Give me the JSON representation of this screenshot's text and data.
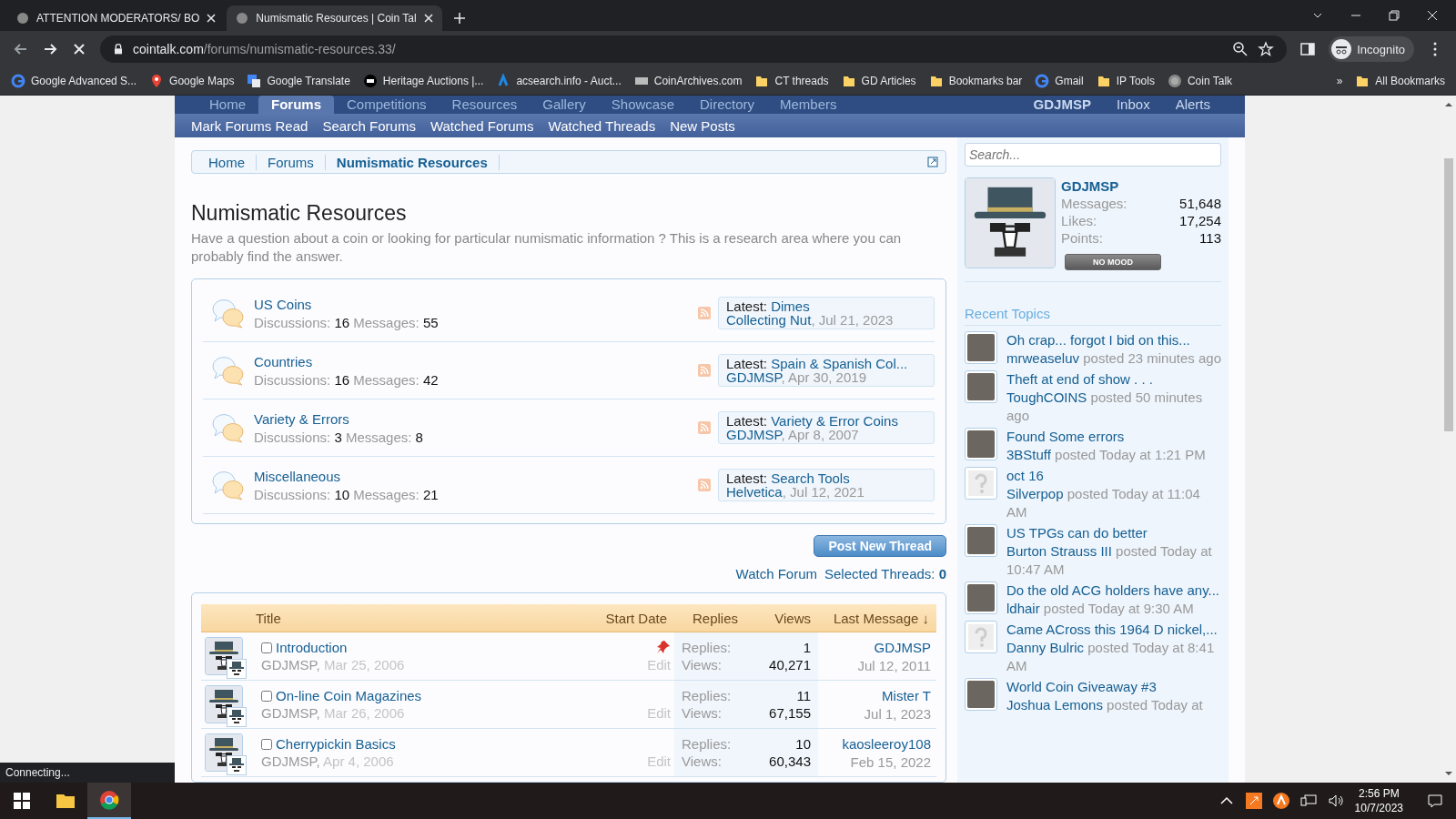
{
  "browser": {
    "tabs": [
      {
        "title": "ATTENTION MODERATORS/ BO",
        "selected": false
      },
      {
        "title": "Numismatic Resources | Coin Tal",
        "selected": true
      }
    ],
    "address": {
      "domain": "cointalk.com",
      "path": "/forums/numismatic-resources.33/"
    },
    "profile": "Incognito",
    "bookmarks": [
      {
        "label": "Google Advanced S...",
        "kind": "google"
      },
      {
        "label": "Google Maps",
        "kind": "pin"
      },
      {
        "label": "Google Translate",
        "kind": "translate"
      },
      {
        "label": "Heritage Auctions |...",
        "kind": "ha"
      },
      {
        "label": "acsearch.info - Auct...",
        "kind": "ac"
      },
      {
        "label": "CoinArchives.com",
        "kind": "ca"
      },
      {
        "label": "CT threads",
        "kind": "folder"
      },
      {
        "label": "GD Articles",
        "kind": "folder"
      },
      {
        "label": "Bookmarks bar",
        "kind": "folder"
      },
      {
        "label": "Gmail",
        "kind": "google"
      },
      {
        "label": "IP Tools",
        "kind": "folder"
      },
      {
        "label": "Coin Talk",
        "kind": "coin"
      }
    ],
    "overflow": "»",
    "all_bookmarks": "All Bookmarks"
  },
  "nav": {
    "items": [
      {
        "label": "Home",
        "selected": false
      },
      {
        "label": "Forums",
        "selected": true
      },
      {
        "label": "Competitions",
        "selected": false
      },
      {
        "label": "Resources",
        "selected": false
      },
      {
        "label": "Gallery",
        "selected": false
      },
      {
        "label": "Showcase",
        "selected": false
      },
      {
        "label": "Directory",
        "selected": false
      },
      {
        "label": "Members",
        "selected": false
      }
    ],
    "user_links": [
      "GDJMSP",
      "Inbox",
      "Alerts"
    ],
    "sub_items": [
      "Mark Forums Read",
      "Search Forums",
      "Watched Forums",
      "Watched Threads",
      "New Posts"
    ],
    "search": {
      "placeholder": "Search..."
    }
  },
  "breadcrumb": [
    {
      "label": "Home",
      "selected": false
    },
    {
      "label": "Forums",
      "selected": false
    },
    {
      "label": "Numismatic Resources",
      "selected": true
    }
  ],
  "title": "Numismatic Resources",
  "description": "Have a question about a coin or looking for particular numismatic information ? This is a research area where you can probably find the answer.",
  "forums": [
    {
      "name": "US Coins",
      "discussions_label": "Discussions:",
      "discussions": "16",
      "messages_label": "Messages:",
      "messages": "55",
      "latest_label": "Latest:",
      "latest_title": "Dimes",
      "latest_user": "Collecting Nut",
      "comma": ",",
      "latest_date": "Jul 21, 2023"
    },
    {
      "name": "Countries",
      "discussions_label": "Discussions:",
      "discussions": "16",
      "messages_label": "Messages:",
      "messages": "42",
      "latest_label": "Latest:",
      "latest_title": "Spain & Spanish Col...",
      "latest_user": "GDJMSP",
      "comma": ",",
      "latest_date": "Apr 30, 2019"
    },
    {
      "name": "Variety & Errors",
      "discussions_label": "Discussions:",
      "discussions": "3",
      "messages_label": "Messages:",
      "messages": "8",
      "latest_label": "Latest:",
      "latest_title": "Variety & Error Coins",
      "latest_user": "GDJMSP",
      "comma": ",",
      "latest_date": "Apr 8, 2007"
    },
    {
      "name": "Miscellaneous",
      "discussions_label": "Discussions:",
      "discussions": "10",
      "messages_label": "Messages:",
      "messages": "21",
      "latest_label": "Latest:",
      "latest_title": "Search Tools",
      "latest_user": "Helvetica",
      "comma": ",",
      "latest_date": "Jul 12, 2021"
    }
  ],
  "post_button": "Post New Thread",
  "watch_forum": "Watch Forum",
  "selected_threads": {
    "label": "Selected Threads:",
    "count": "0"
  },
  "table": {
    "columns": [
      "Title",
      "Start Date",
      "Replies",
      "Views",
      "Last Message ↓"
    ],
    "rows": [
      {
        "checked": false,
        "title": "Introduction",
        "author": "GDJMSP",
        "comma": ",",
        "date": "Mar 25, 2006",
        "sticky": true,
        "edit": "Edit",
        "replies_label": "Replies:",
        "replies": "1",
        "views_label": "Views:",
        "views": "40,271",
        "last_user": "GDJMSP",
        "last_date": "Jul 12, 2011"
      },
      {
        "checked": false,
        "title": "On-line Coin Magazines",
        "author": "GDJMSP",
        "comma": ",",
        "date": "Mar 26, 2006",
        "sticky": false,
        "edit": "Edit",
        "replies_label": "Replies:",
        "replies": "11",
        "views_label": "Views:",
        "views": "67,155",
        "last_user": "Mister T",
        "last_date": "Jul 1, 2023"
      },
      {
        "checked": false,
        "title": "Cherrypickin Basics",
        "author": "GDJMSP",
        "comma": ",",
        "date": "Apr 4, 2006",
        "sticky": false,
        "edit": "Edit",
        "replies_label": "Replies:",
        "replies": "10",
        "views_label": "Views:",
        "views": "60,343",
        "last_user": "kaosleeroy108",
        "last_date": "Feb 15, 2022"
      }
    ]
  },
  "sidebar": {
    "user": {
      "name": "GDJMSP",
      "stats": [
        {
          "label": "Messages:",
          "value": "51,648"
        },
        {
          "label": "Likes:",
          "value": "17,254"
        },
        {
          "label": "Points:",
          "value": "113"
        }
      ],
      "mood": "NO MOOD"
    },
    "recent_title": "Recent Topics",
    "topics": [
      {
        "title": "Oh crap... forgot I bid on this...",
        "user": "mrweaseluv",
        "posted": "posted 23 minutes ago",
        "kind": "photo"
      },
      {
        "title": "Theft at end of show . . .",
        "user": "ToughCOINS",
        "posted": "posted 50 minutes ago",
        "kind": "photo"
      },
      {
        "title": "Found Some errors",
        "user": "3BStuff",
        "posted": "posted Today at 1:21 PM",
        "kind": "photo"
      },
      {
        "title": "oct 16",
        "user": "Silverpop",
        "posted": "posted Today at 11:04 AM",
        "kind": "unknown"
      },
      {
        "title": "US TPGs can do better",
        "user": "Burton Strauss III",
        "posted": "posted Today at 10:47 AM",
        "kind": "photo"
      },
      {
        "title": "Do the old ACG holders have any...",
        "user": "ldhair",
        "posted": "posted Today at 9:30 AM",
        "kind": "photo"
      },
      {
        "title": "Came ACross this 1964 D nickel,...",
        "user": "Danny Bulric",
        "posted": "posted Today at 8:41 AM",
        "kind": "unknown"
      },
      {
        "title": "World Coin Giveaway #3",
        "user": "Joshua Lemons",
        "posted": "posted Today at",
        "kind": "photo"
      }
    ]
  },
  "status": "Connecting...",
  "taskbar": {
    "time": "2:56 PM",
    "date": "10/7/2023"
  }
}
